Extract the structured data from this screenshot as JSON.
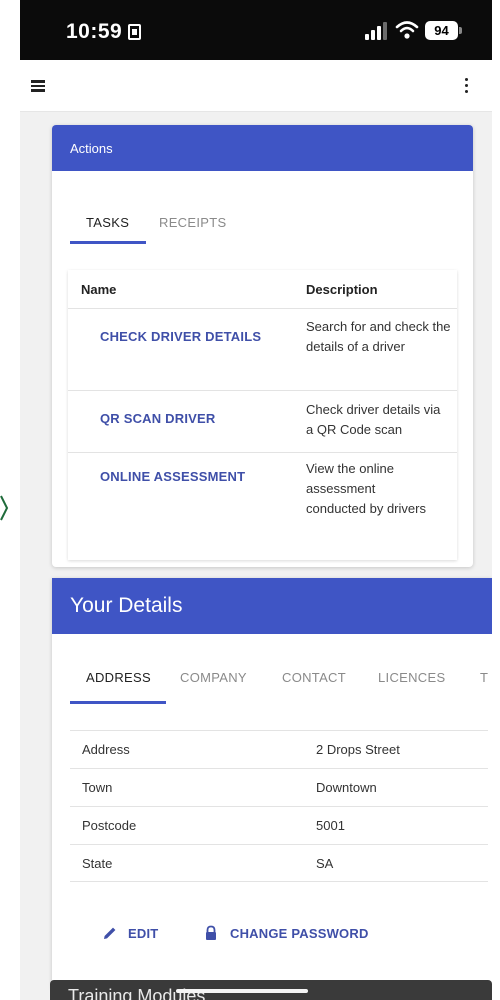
{
  "status_bar": {
    "time": "10:59",
    "battery": "94"
  },
  "actions": {
    "title": "Actions",
    "tabs": [
      "TASKS",
      "RECEIPTS"
    ],
    "table": {
      "headers": [
        "Name",
        "Description"
      ],
      "rows": [
        {
          "name": "CHECK DRIVER DETAILS",
          "description": "Search for and check the details of a driver"
        },
        {
          "name": "QR SCAN DRIVER",
          "description": "Check driver details via a QR Code scan"
        },
        {
          "name": "ONLINE ASSESSMENT",
          "description": "View the online assessment conducted by drivers"
        }
      ]
    }
  },
  "your_details": {
    "title": "Your Details",
    "tabs": [
      "ADDRESS",
      "COMPANY",
      "CONTACT",
      "LICENCES",
      "T"
    ],
    "rows": [
      {
        "label": "Address",
        "value": "2 Drops Street"
      },
      {
        "label": "Town",
        "value": "Downtown"
      },
      {
        "label": "Postcode",
        "value": "5001"
      },
      {
        "label": "State",
        "value": "SA"
      }
    ],
    "edit_label": "EDIT",
    "change_password_label": "CHANGE PASSWORD"
  },
  "training": {
    "title": "Training Modules"
  },
  "colors": {
    "primary": "#3f55c5",
    "link": "#3f4fa8",
    "status_bar": "#0b0b0b"
  }
}
